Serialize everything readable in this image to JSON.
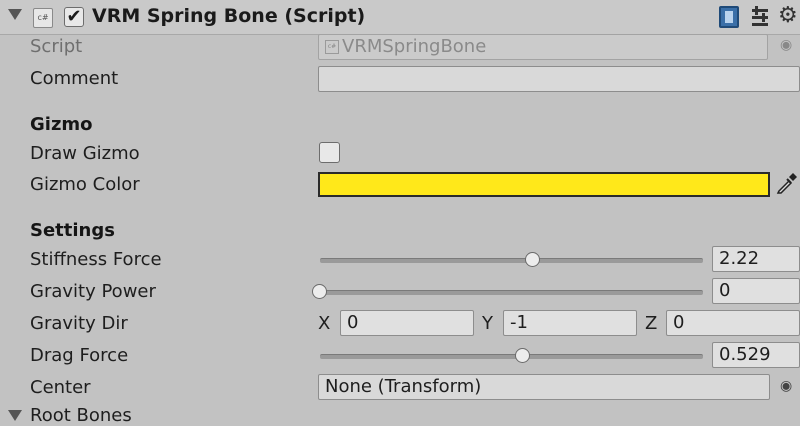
{
  "header": {
    "title": "VRM Spring Bone (Script)",
    "enabled": true,
    "script_icon_text": "c#"
  },
  "fields": {
    "script": {
      "label": "Script",
      "value": "VRMSpringBone",
      "icon_text": "c#"
    },
    "comment": {
      "label": "Comment",
      "value": ""
    }
  },
  "gizmo": {
    "section": "Gizmo",
    "draw_gizmo": {
      "label": "Draw Gizmo",
      "checked": false
    },
    "gizmo_color": {
      "label": "Gizmo Color",
      "color": "#ffe81a"
    }
  },
  "settings": {
    "section": "Settings",
    "stiffness_force": {
      "label": "Stiffness Force",
      "value": "2.22",
      "slider_fraction": 0.555
    },
    "gravity_power": {
      "label": "Gravity Power",
      "value": "0",
      "slider_fraction": 0.0
    },
    "gravity_dir": {
      "label": "Gravity Dir",
      "x_label": "X",
      "x": "0",
      "y_label": "Y",
      "y": "-1",
      "z_label": "Z",
      "z": "0"
    },
    "drag_force": {
      "label": "Drag Force",
      "value": "0.529",
      "slider_fraction": 0.529
    },
    "center": {
      "label": "Center",
      "value": "None (Transform)"
    }
  },
  "next_section": "Root Bones",
  "icons": {
    "header": [
      "fold-arrow-icon",
      "script-icon",
      "book-icon",
      "sliders-icon",
      "gear-icon"
    ],
    "fields": [
      "object-picker-icon",
      "eyedropper-icon"
    ]
  }
}
